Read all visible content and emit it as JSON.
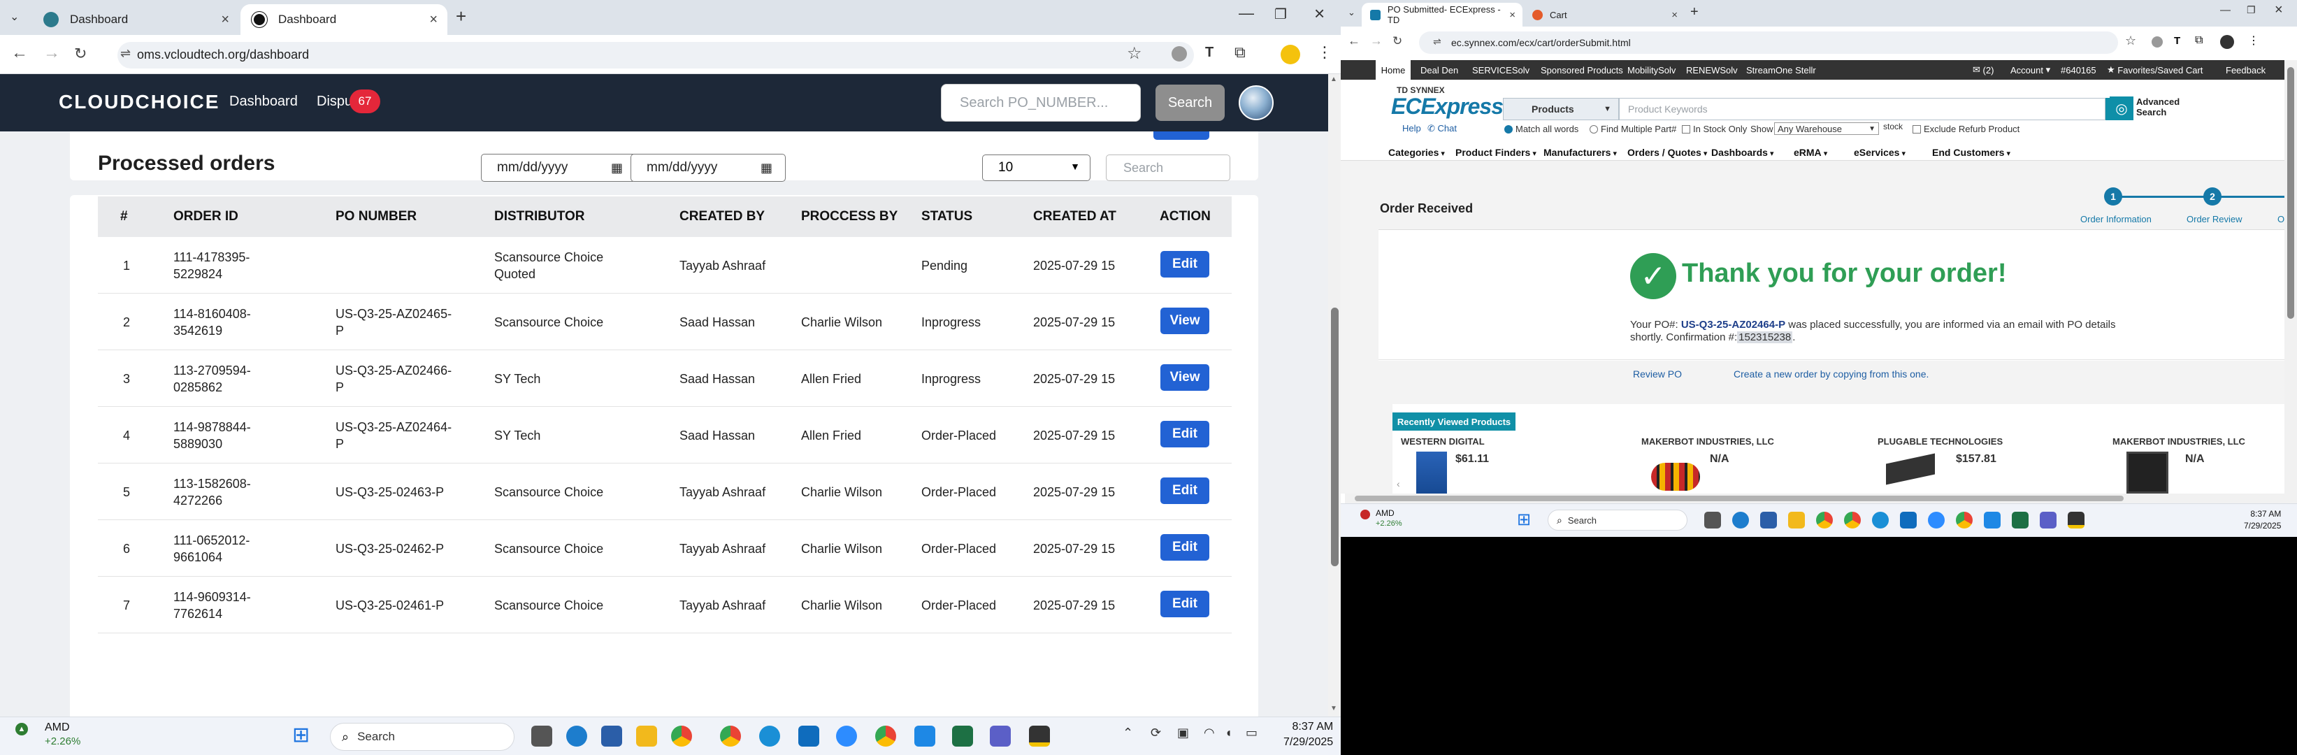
{
  "left": {
    "tabs": [
      {
        "title": "Dashboard",
        "active": false
      },
      {
        "title": "Dashboard",
        "active": true
      }
    ],
    "address": "oms.vcloudtech.org/dashboard",
    "app": {
      "logo": "CLOUDCHOICE",
      "nav_dashboard": "Dashboard",
      "nav_disputes": "Dispu",
      "disputes_badge": "67",
      "search_placeholder": "Search PO_NUMBER...",
      "search_button": "Search"
    },
    "section_title": "Processed orders",
    "date_from": "mm/dd/yyyy",
    "date_to": "mm/dd/yyyy",
    "page_size": "10",
    "table_search_placeholder": "Search",
    "columns": [
      "#",
      "ORDER ID",
      "PO NUMBER",
      "DISTRIBUTOR",
      "CREATED BY",
      "PROCCESS BY",
      "STATUS",
      "CREATED AT",
      "ACTION"
    ],
    "rows": [
      {
        "n": "1",
        "order_id": "111-4178395-5229824",
        "po": "",
        "distributor": "Scansource Choice Quoted",
        "created_by": "Tayyab Ashraaf",
        "process_by": "",
        "status": "Pending",
        "created_at": "2025-07-29 15",
        "action": "Edit"
      },
      {
        "n": "2",
        "order_id": "114-8160408-3542619",
        "po": "US-Q3-25-AZ02465-P",
        "distributor": "Scansource Choice",
        "created_by": "Saad Hassan",
        "process_by": "Charlie Wilson",
        "status": "Inprogress",
        "created_at": "2025-07-29 15",
        "action": "View"
      },
      {
        "n": "3",
        "order_id": "113-2709594-0285862",
        "po": "US-Q3-25-AZ02466-P",
        "distributor": "SY Tech",
        "created_by": "Saad Hassan",
        "process_by": "Allen Fried",
        "status": "Inprogress",
        "created_at": "2025-07-29 15",
        "action": "View"
      },
      {
        "n": "4",
        "order_id": "114-9878844-5889030",
        "po": "US-Q3-25-AZ02464-P",
        "distributor": "SY Tech",
        "created_by": "Saad Hassan",
        "process_by": "Allen Fried",
        "status": "Order-Placed",
        "created_at": "2025-07-29 15",
        "action": "Edit"
      },
      {
        "n": "5",
        "order_id": "113-1582608-4272266",
        "po": "US-Q3-25-02463-P",
        "distributor": "Scansource Choice",
        "created_by": "Tayyab Ashraaf",
        "process_by": "Charlie Wilson",
        "status": "Order-Placed",
        "created_at": "2025-07-29 15",
        "action": "Edit"
      },
      {
        "n": "6",
        "order_id": "111-0652012-9661064",
        "po": "US-Q3-25-02462-P",
        "distributor": "Scansource Choice",
        "created_by": "Tayyab Ashraaf",
        "process_by": "Charlie Wilson",
        "status": "Order-Placed",
        "created_at": "2025-07-29 15",
        "action": "Edit"
      },
      {
        "n": "7",
        "order_id": "114-9609314-7762614",
        "po": "US-Q3-25-02461-P",
        "distributor": "Scansource Choice",
        "created_by": "Tayyab Ashraaf",
        "process_by": "Charlie Wilson",
        "status": "Order-Placed",
        "created_at": "2025-07-29 15",
        "action": "Edit"
      }
    ],
    "taskbar": {
      "stock_name": "AMD",
      "stock_change": "+2.26%",
      "search": "Search",
      "time": "8:37 AM",
      "date": "7/29/2025"
    }
  },
  "right": {
    "tabs": [
      {
        "title": "PO Submitted- ECExpress - TD",
        "active": true
      },
      {
        "title": "Cart",
        "active": false
      }
    ],
    "address": "ec.synnex.com/ecx/cart/orderSubmit.html",
    "topnav": [
      "Home",
      "Deal Den",
      "SERVICESolv",
      "Sponsored Products",
      "MobilitySolv",
      "RENEWSolv",
      "StreamOne Stellr"
    ],
    "topnav_right": {
      "msgs": "(2)",
      "account": "Account",
      "acct_no": "#640165",
      "favorites": "Favorites/Saved Cart",
      "feedback": "Feedback"
    },
    "logo_top": "TD SYNNEX",
    "logo_main": "ECExpress",
    "search_category": "Products",
    "search_placeholder": "Product Keywords",
    "advanced_search": "Advanced Search",
    "help": "Help",
    "chat": "Chat",
    "opt_match": "Match all words",
    "opt_multi": "Find Multiple Part#",
    "opt_stock": "In Stock Only",
    "opt_show": "Show",
    "opt_warehouse": "Any Warehouse",
    "opt_stock2": "stock",
    "opt_refurb": "Exclude Refurb Product",
    "menu": [
      "Categories",
      "Product Finders",
      "Manufacturers",
      "Orders / Quotes",
      "Dashboards",
      "eRMA",
      "eServices",
      "End Customers"
    ],
    "order_received": "Order Received",
    "step1_num": "1",
    "step1_label": "Order Information",
    "step2_num": "2",
    "step2_label": "Order Review",
    "step3_label": "Or",
    "thanks": "Thank you for your order!",
    "msg_pre": "Your PO#:",
    "po_number": "US-Q3-25-AZ02464-P",
    "msg_mid": "was placed successfully, you are informed via an email with PO details shortly. Confirmation #:",
    "confirmation": "152315238",
    "msg_end": ".",
    "review_po": "Review PO",
    "new_order": "Create a new order by copying from this one.",
    "recently_viewed": "Recently Viewed Products",
    "products": [
      {
        "vendor": "WESTERN DIGITAL",
        "price": "$61.11"
      },
      {
        "vendor": "MAKERBOT INDUSTRIES, LLC",
        "price": "N/A"
      },
      {
        "vendor": "PLUGABLE TECHNOLOGIES",
        "price": "$157.81"
      },
      {
        "vendor": "MAKERBOT INDUSTRIES, LLC",
        "price": "N/A"
      }
    ],
    "taskbar": {
      "stock_name": "AMD",
      "stock_change": "+2.26%",
      "search": "Search",
      "time": "8:37 AM",
      "date": "7/29/2025"
    }
  }
}
